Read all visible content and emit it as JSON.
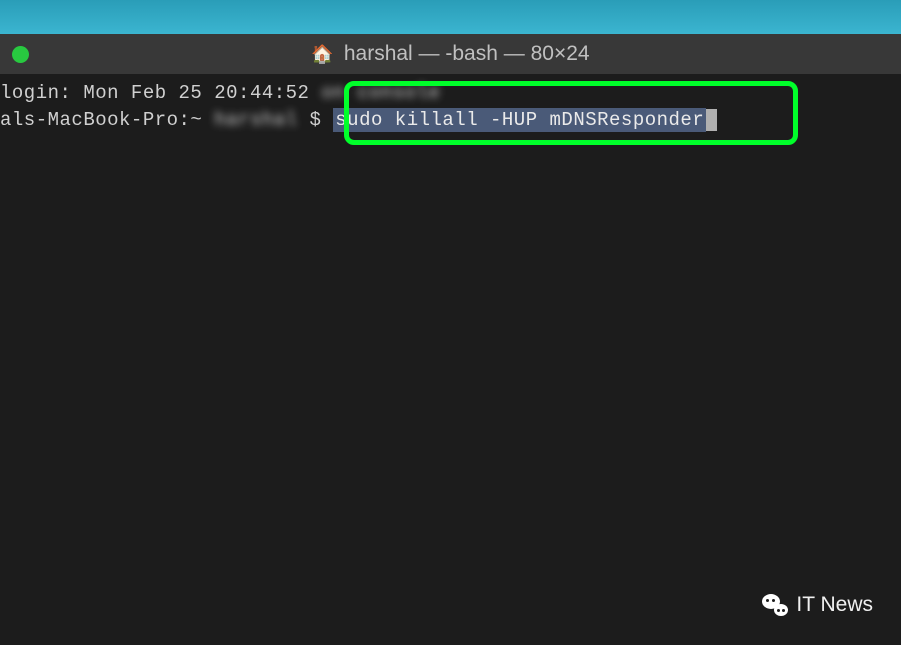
{
  "titlebar": {
    "home_icon": "🏠",
    "title": "harshal — -bash — 80×24"
  },
  "terminal": {
    "login_prefix": "login: Mon Feb 25 20:44:52 ",
    "login_blurred": "on console",
    "prompt_host": "als-MacBook-Pro:~ ",
    "prompt_blurred": "harshal",
    "prompt_dollar": " $ ",
    "command": "sudo killall -HUP mDNSResponder"
  },
  "watermark": {
    "label": "IT News"
  }
}
